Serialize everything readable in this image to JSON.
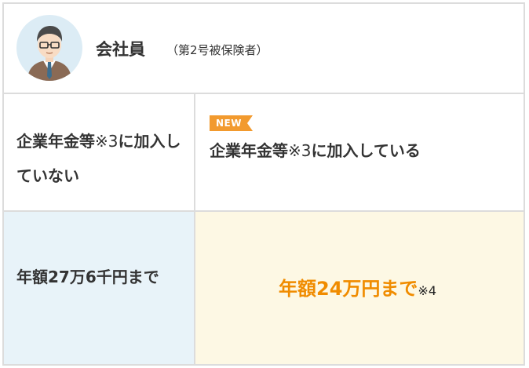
{
  "header": {
    "title": "会社員",
    "subtitle": "（第2号被保険者）",
    "avatar_icon": "businessman-avatar-icon"
  },
  "columns": [
    {
      "condition_text": "企業年金等",
      "condition_note": "※3",
      "condition_tail": "に加入していない",
      "limit_text": "年額27万6千円まで"
    },
    {
      "badge": "NEW",
      "condition_text": "企業年金等",
      "condition_note": "※3",
      "condition_tail": "に加入している",
      "limit_text": "年額24万円まで",
      "limit_note": "※4"
    }
  ],
  "colors": {
    "border": "#dcdcdc",
    "left_bottom_bg": "#e8f3f9",
    "right_bottom_bg": "#fdf8e4",
    "accent_orange": "#f08c00",
    "badge_bg": "#f29a2e"
  }
}
